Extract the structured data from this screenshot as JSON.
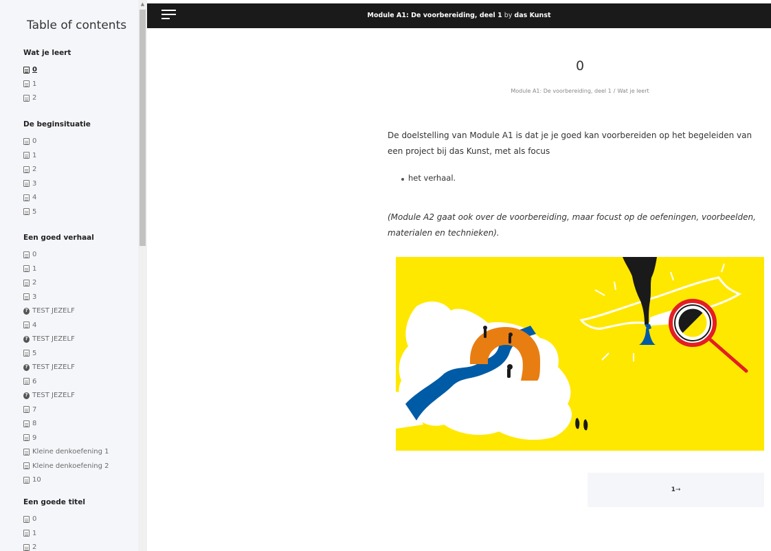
{
  "sidebar": {
    "title": "Table of contents",
    "sections": [
      {
        "heading": "Wat je leert",
        "items": [
          {
            "label": "0",
            "icon": "document-icon",
            "active": true
          },
          {
            "label": "1",
            "icon": "document-icon"
          },
          {
            "label": "2",
            "icon": "document-icon"
          }
        ]
      },
      {
        "heading": "De beginsituatie",
        "items": [
          {
            "label": "0",
            "icon": "document-icon"
          },
          {
            "label": "1",
            "icon": "document-icon"
          },
          {
            "label": "2",
            "icon": "document-icon"
          },
          {
            "label": "3",
            "icon": "document-icon"
          },
          {
            "label": "4",
            "icon": "document-icon"
          },
          {
            "label": "5",
            "icon": "document-icon"
          }
        ]
      },
      {
        "heading": "Een goed verhaal",
        "items": [
          {
            "label": "0",
            "icon": "document-icon"
          },
          {
            "label": "1",
            "icon": "document-icon"
          },
          {
            "label": "2",
            "icon": "document-icon"
          },
          {
            "label": "3",
            "icon": "document-icon"
          },
          {
            "label": "TEST JEZELF",
            "icon": "question-icon"
          },
          {
            "label": "4",
            "icon": "document-icon"
          },
          {
            "label": "TEST JEZELF",
            "icon": "question-icon"
          },
          {
            "label": "5",
            "icon": "document-icon"
          },
          {
            "label": "TEST JEZELF",
            "icon": "question-icon"
          },
          {
            "label": "6",
            "icon": "document-icon"
          },
          {
            "label": "TEST JEZELF",
            "icon": "question-icon"
          },
          {
            "label": "7",
            "icon": "document-icon"
          },
          {
            "label": "8",
            "icon": "document-icon"
          },
          {
            "label": "9",
            "icon": "document-icon"
          },
          {
            "label": "Kleine denkoefening 1",
            "icon": "document-icon"
          },
          {
            "label": "Kleine denkoefening 2",
            "icon": "document-icon"
          },
          {
            "label": "10",
            "icon": "document-icon"
          }
        ]
      },
      {
        "heading": "Een goede titel",
        "items": [
          {
            "label": "0",
            "icon": "document-icon"
          },
          {
            "label": "1",
            "icon": "document-icon"
          },
          {
            "label": "2",
            "icon": "document-icon"
          }
        ]
      }
    ]
  },
  "header": {
    "module_title": "Module A1: De voorbereiding, deel 1",
    "by_label": "by",
    "author": "das Kunst"
  },
  "page": {
    "heading": "0",
    "breadcrumb": {
      "parent": "Module A1: De voorbereiding, deel 1",
      "separator": "/",
      "current": "Wat je leert"
    },
    "paragraph1": "De doelstelling van Module A1 is dat je je goed kan voorbereiden op het begeleiden van een project bij das Kunst, met als focus",
    "bullet": "het verhaal.",
    "paragraph2": "(Module A2 gaat ook over de voorbereiding, maar focust op de oefeningen, voorbeelden, materialen en technieken).",
    "next_label": "1",
    "next_arrow": "→"
  },
  "colors": {
    "illustration_background": "#ffe800",
    "river": "#005ba6",
    "bridge": "#e87e12",
    "magnifier_ring": "#e31e24",
    "ink": "#1a1a1a",
    "topbar": "#1a1a1a"
  }
}
